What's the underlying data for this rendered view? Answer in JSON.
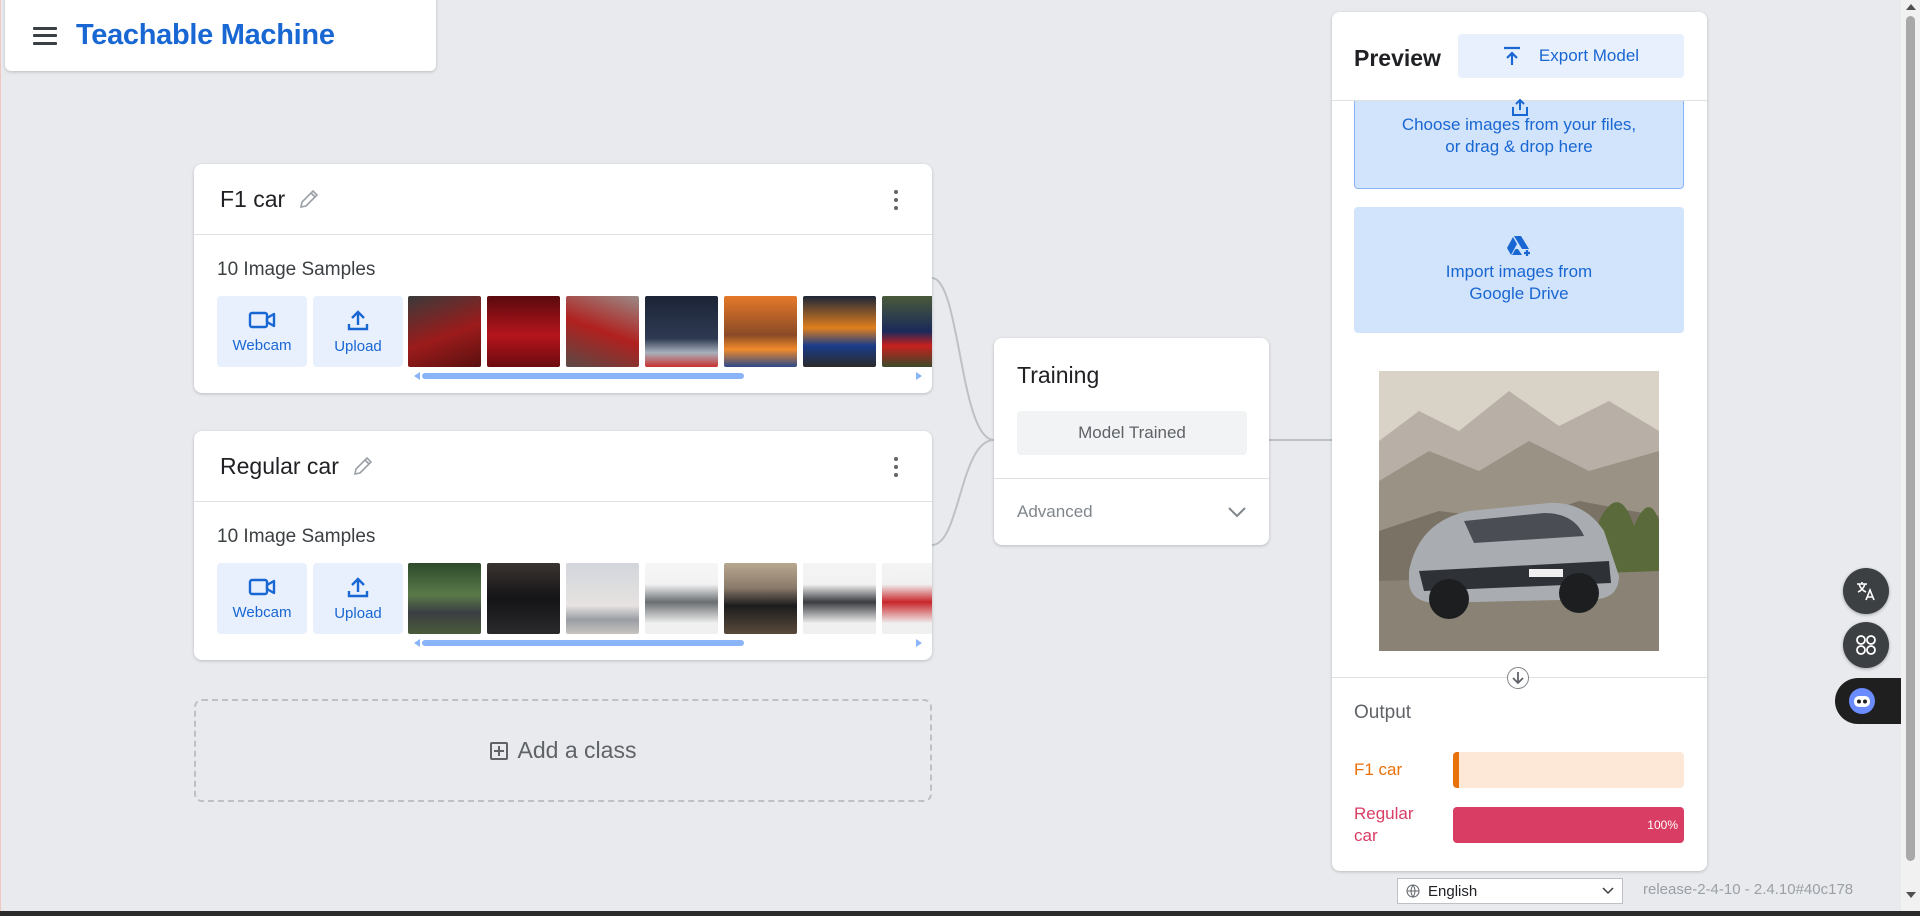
{
  "app": {
    "title": "Teachable Machine"
  },
  "classes": [
    {
      "name": "F1 car",
      "samples_label": "10 Image Samples",
      "webcam_label": "Webcam",
      "upload_label": "Upload",
      "thumb_colors": [
        "#6b1a1a",
        "#8b0f15",
        "#7a3a36",
        "#2a3444",
        "#c46a2c",
        "#2c3550",
        "#3b4a3a"
      ]
    },
    {
      "name": "Regular car",
      "samples_label": "10 Image Samples",
      "webcam_label": "Webcam",
      "upload_label": "Upload",
      "thumb_colors": [
        "#3d5a3a",
        "#2a2a2e",
        "#d6d4d6",
        "#8f9397",
        "#a08a7a",
        "#7b7e82",
        "#c8363a"
      ]
    }
  ],
  "add_class": {
    "label": "Add a class"
  },
  "training": {
    "title": "Training",
    "status_label": "Model Trained",
    "advanced_label": "Advanced"
  },
  "preview": {
    "title": "Preview",
    "export_label": "Export Model",
    "drop_line1": "Choose images from your files,",
    "drop_line2": "or drag & drop here",
    "drive_line1": "Import images from",
    "drive_line2": "Google Drive",
    "output_title": "Output",
    "outputs": [
      {
        "label": "F1 car",
        "value": 0,
        "color": "#e8710a",
        "track": "#fde8d8",
        "percent_text": ""
      },
      {
        "label_line1": "Regular",
        "label_line2": "car",
        "value": 1.0,
        "color": "#d93d63",
        "track": "#fbdde5",
        "percent_text": "100%"
      }
    ]
  },
  "footer": {
    "language": "English",
    "release": "release-2-4-10 - 2.4.10#40c178"
  }
}
